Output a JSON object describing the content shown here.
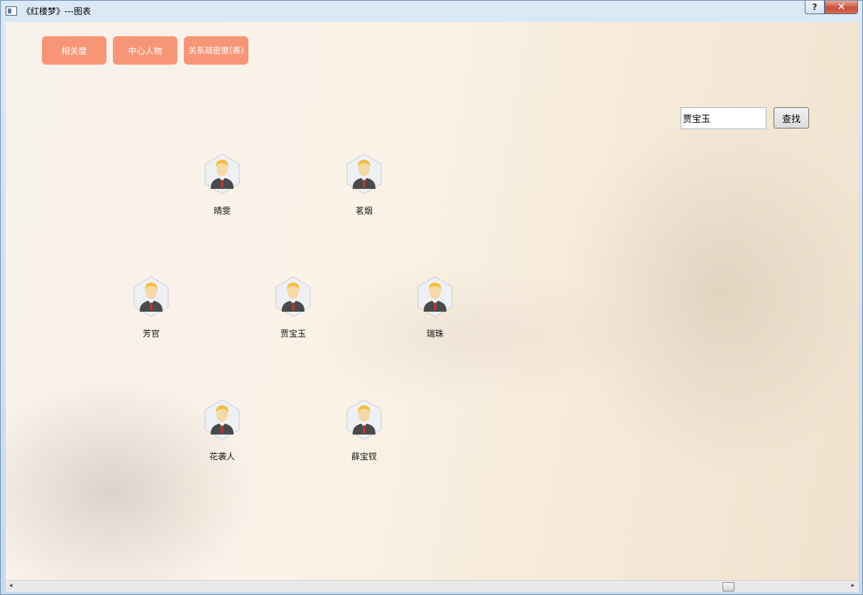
{
  "window": {
    "title": "《红楼梦》---图表",
    "help_glyph": "?",
    "close_glyph": "✕"
  },
  "toolbar": {
    "buttons": [
      {
        "label": "相关度"
      },
      {
        "label": "中心人物"
      },
      {
        "label": "关系疏密度(表)"
      }
    ]
  },
  "search": {
    "value": "贾宝玉",
    "button_label": "查找"
  },
  "nodes": [
    {
      "name": "晴雯",
      "icon": "person-avatar-icon"
    },
    {
      "name": "茗烟",
      "icon": "person-avatar-icon"
    },
    {
      "name": "芳官",
      "icon": "person-avatar-icon"
    },
    {
      "name": "贾宝玉",
      "icon": "person-avatar-icon"
    },
    {
      "name": "瑞珠",
      "icon": "person-avatar-icon"
    },
    {
      "name": "花袭人",
      "icon": "person-avatar-icon"
    },
    {
      "name": "薛宝钗",
      "icon": "person-avatar-icon"
    }
  ],
  "scrollbar": {
    "left_arrow": "◂",
    "right_arrow": "▸"
  },
  "colors": {
    "accent_button": "#f79676",
    "avatar_hair": "#f0c040",
    "avatar_suit": "#4a4a4a",
    "avatar_tie": "#c0392b"
  }
}
